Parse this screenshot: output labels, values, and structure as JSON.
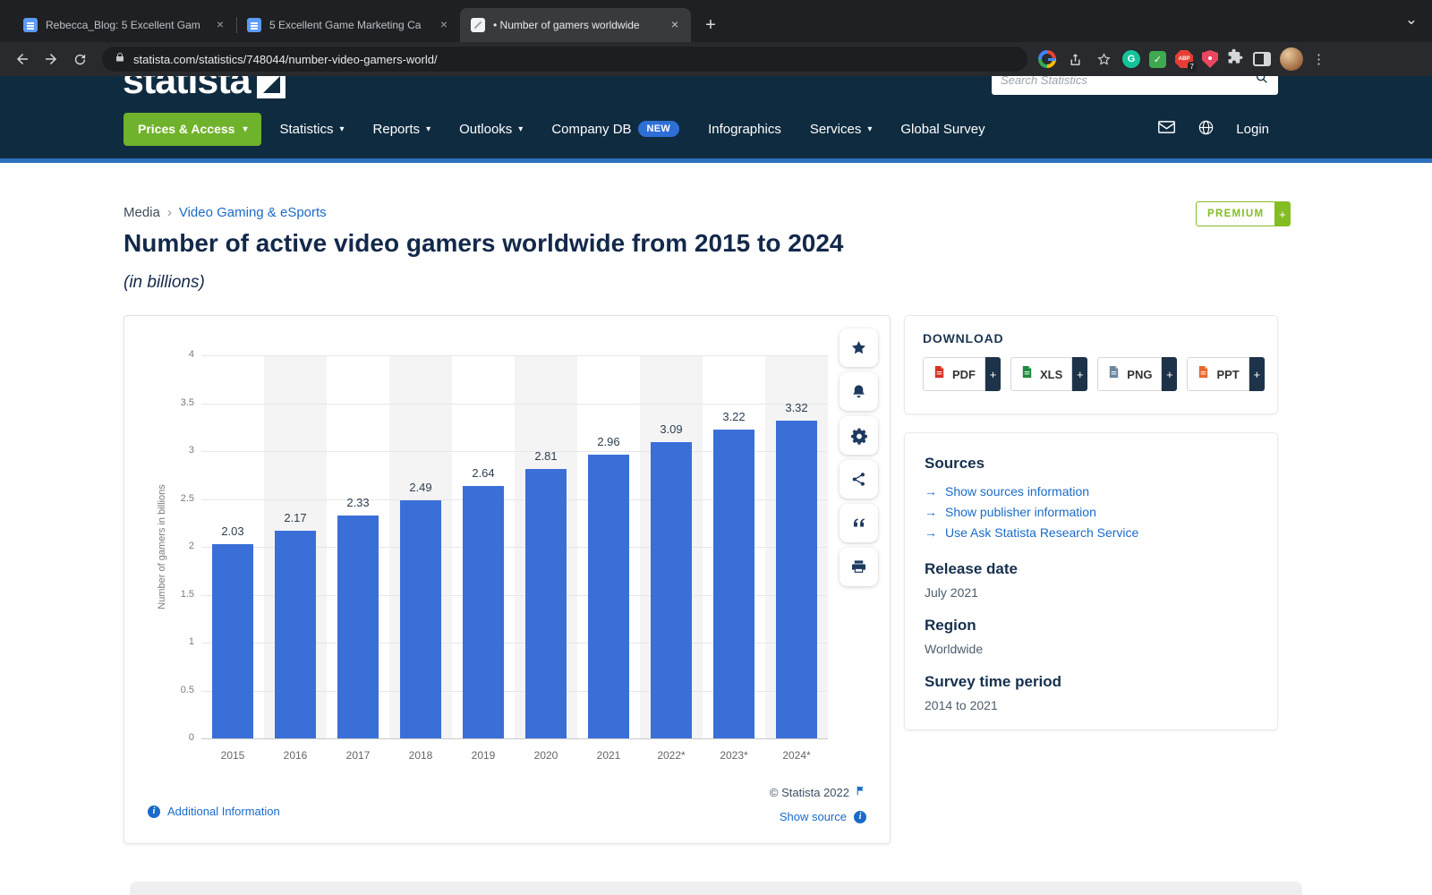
{
  "colors": {
    "header_navy": "#0f2b40",
    "accent_green": "#6fb22b",
    "link_blue": "#1a6bc9",
    "bar_blue": "#3a6fd8",
    "new_badge_blue": "#2e6fd6",
    "premium_green": "#84bd22",
    "title_navy": "#13294b"
  },
  "icons": {
    "close": "×",
    "plus": "+",
    "caret": "▾",
    "chevron_down": "⌄",
    "breadcrumb_sep": "›",
    "arrow_right": "→",
    "info": "i",
    "kebab": "⋮",
    "check": "✓",
    "abp": "ABP",
    "abp_badge": "7",
    "grammarly": "G"
  },
  "browser": {
    "tabs": [
      {
        "title": "Rebecca_Blog: 5 Excellent Gam",
        "active": false
      },
      {
        "title": "5 Excellent Game Marketing Ca",
        "active": false
      },
      {
        "title": "• Number of gamers worldwide",
        "active": true
      }
    ],
    "url": "statista.com/statistics/748044/number-video-gamers-world/"
  },
  "site_header": {
    "logo": "statista",
    "search_placeholder": "Search Statistics",
    "prices_button": "Prices & Access",
    "nav": [
      {
        "label": "Statistics",
        "caret": true
      },
      {
        "label": "Reports",
        "caret": true
      },
      {
        "label": "Outlooks",
        "caret": true
      },
      {
        "label": "Company DB",
        "badge": "NEW"
      },
      {
        "label": "Infographics"
      },
      {
        "label": "Services",
        "caret": true
      },
      {
        "label": "Global Survey"
      }
    ],
    "login": "Login"
  },
  "page": {
    "breadcrumb": {
      "section": "Media",
      "category": "Video Gaming & eSports"
    },
    "premium_label": "PREMIUM",
    "title": "Number of active video gamers worldwide from 2015 to 2024",
    "subtitle": "(in billions)"
  },
  "chart_data": {
    "type": "bar",
    "title": "Number of active video gamers worldwide from 2015 to 2024",
    "subtitle": "(in billions)",
    "categories": [
      "2015",
      "2016",
      "2017",
      "2018",
      "2019",
      "2020",
      "2021",
      "2022*",
      "2023*",
      "2024*"
    ],
    "values": [
      2.03,
      2.17,
      2.33,
      2.49,
      2.64,
      2.81,
      2.96,
      3.09,
      3.22,
      3.32
    ],
    "xlabel": "",
    "ylabel": "Number of gamers in billions",
    "ylim": [
      0,
      4
    ],
    "yticks": [
      0,
      0.5,
      1,
      1.5,
      2,
      2.5,
      3,
      3.5,
      4
    ],
    "grid": true,
    "legend": "none",
    "bar_color": "#3a6fd8",
    "band_color": "#f4f4f4",
    "copyright": "© Statista 2022",
    "additional_information": "Additional Information",
    "show_source": "Show source"
  },
  "download": {
    "heading": "DOWNLOAD",
    "formats": [
      {
        "label": "PDF",
        "color": "#d93025"
      },
      {
        "label": "XLS",
        "color": "#1f8a3b"
      },
      {
        "label": "PNG",
        "color": "#6e86a0"
      },
      {
        "label": "PPT",
        "color": "#e8682d"
      }
    ]
  },
  "details": {
    "sources_heading": "Sources",
    "links": [
      "Show sources information",
      "Show publisher information",
      "Use Ask Statista Research Service"
    ],
    "release_date_heading": "Release date",
    "release_date": "July 2021",
    "region_heading": "Region",
    "region": "Worldwide",
    "survey_heading": "Survey time period",
    "survey": "2014 to 2021"
  }
}
